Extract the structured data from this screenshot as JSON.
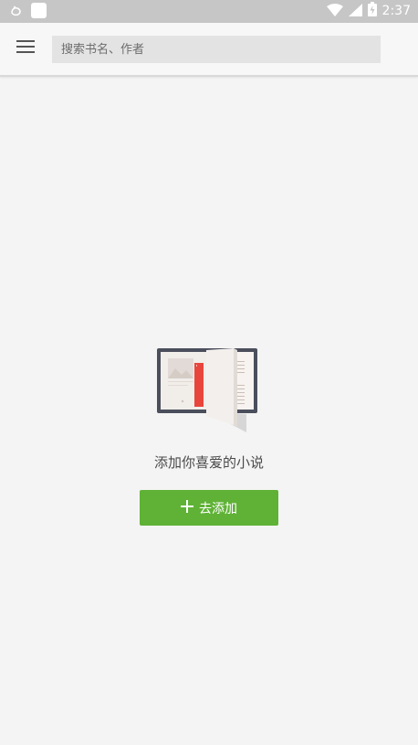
{
  "status_bar": {
    "time": "2:37",
    "icons": [
      "notification-icon",
      "app-icon",
      "wifi-icon",
      "signal-icon",
      "battery-icon"
    ]
  },
  "header": {
    "menu_icon": "menu-icon",
    "search": {
      "placeholder": "搜索书名、作者",
      "value": ""
    }
  },
  "empty_state": {
    "illustration": "book-illustration",
    "message": "添加你喜爱的小说",
    "button_icon": "plus-icon",
    "button_label": "去添加"
  },
  "colors": {
    "accent": "#5fb236",
    "background": "#f4f4f4",
    "status_bar": "#c6c6c6",
    "bookmark": "#e8453c"
  }
}
